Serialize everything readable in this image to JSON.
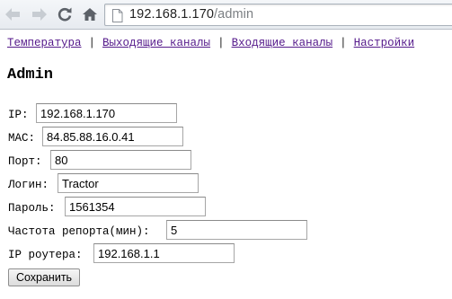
{
  "browser": {
    "url_host": "192.168.1.170",
    "url_path": "/admin"
  },
  "nav": {
    "links": [
      "Температура",
      "Выходящие каналы",
      "Входящие каналы",
      "Настройки"
    ],
    "separator": "|"
  },
  "page": {
    "title": "Admin"
  },
  "form": {
    "ip": {
      "label": "IP:",
      "value": "192.168.1.170"
    },
    "mac": {
      "label": "MAC:",
      "value": "84.85.88.16.0.41"
    },
    "port": {
      "label": "Порт:",
      "value": "80"
    },
    "login": {
      "label": "Логин:",
      "value": "Tractor"
    },
    "password": {
      "label": "Пароль:",
      "value": "1561354"
    },
    "report_freq": {
      "label": "Частота репорта(мин):",
      "value": "5"
    },
    "router_ip": {
      "label": "IP роутера:",
      "value": "192.168.1.1"
    },
    "save_label": "Сохранить"
  },
  "icons": {
    "back": "back-arrow-icon",
    "forward": "forward-arrow-icon",
    "reload": "reload-icon",
    "home": "home-icon",
    "page": "page-icon"
  },
  "colors": {
    "link_visited": "#551a8b",
    "url_path": "#7b7f83"
  }
}
